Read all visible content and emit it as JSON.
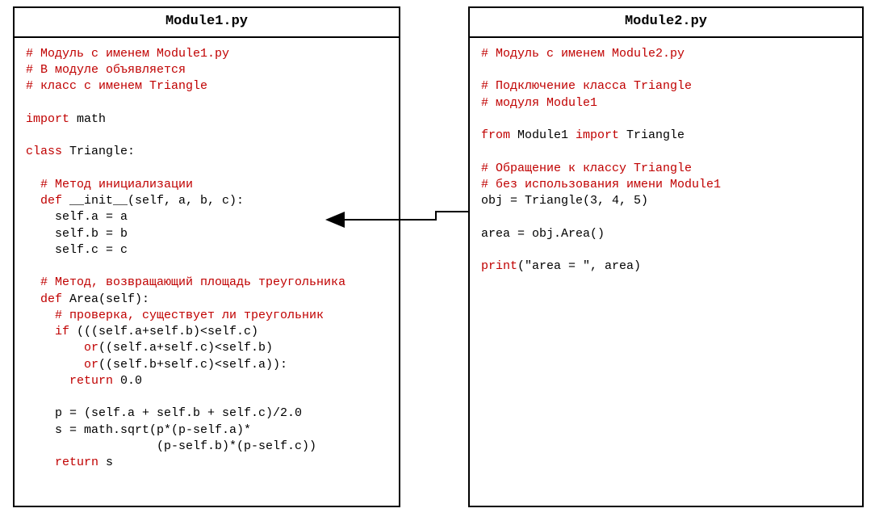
{
  "module1": {
    "title": "Module1.py",
    "c1": "# Модуль с именем Module1.py",
    "c2": "# В модуле объявляется",
    "c3": "# класс с именем Triangle",
    "importKw": "import",
    "importName": " math",
    "classKw": "class",
    "className": " Triangle:",
    "c4": "  # Метод инициализации",
    "defKw1": "  def",
    "defSig1": " __init__(self, a, b, c):",
    "b1": "    self.a = a",
    "b2": "    self.b = b",
    "b3": "    self.c = c",
    "c5": "  # Метод, возвращающий площадь треугольника",
    "defKw2": "  def",
    "defSig2": " Area(self):",
    "c6": "    # проверка, существует ли треугольник",
    "ifKw": "    if",
    "ifCond": " (((self.a+self.b)<self.c)",
    "orKw1": "        or",
    "orCond1": "((self.a+self.c)<self.b)",
    "orKw2": "        or",
    "orCond2": "((self.b+self.c)<self.a)):",
    "retKw1": "      return",
    "retVal1": " 0.0",
    "p1": "    p = (self.a + self.b + self.c)/2.0",
    "p2": "    s = math.sqrt(p*(p-self.a)*",
    "p3": "                  (p-self.b)*(p-self.c))",
    "retKw2": "    return",
    "retVal2": " s"
  },
  "module2": {
    "title": "Module2.py",
    "c1": "# Модуль с именем Module2.py",
    "c2": "# Подключение класса Triangle",
    "c3": "# модуля Module1",
    "fromKw": "from",
    "fromMod": " Module1 ",
    "importKw": "import",
    "importName": " Triangle",
    "c4": "# Обращение к классу Triangle",
    "c5": "# без использования имени Module1",
    "l1": "obj = Triangle(3, 4, 5)",
    "l2": "area = obj.Area()",
    "printKw": "print",
    "printArgs": "(\"area = \", area)"
  }
}
